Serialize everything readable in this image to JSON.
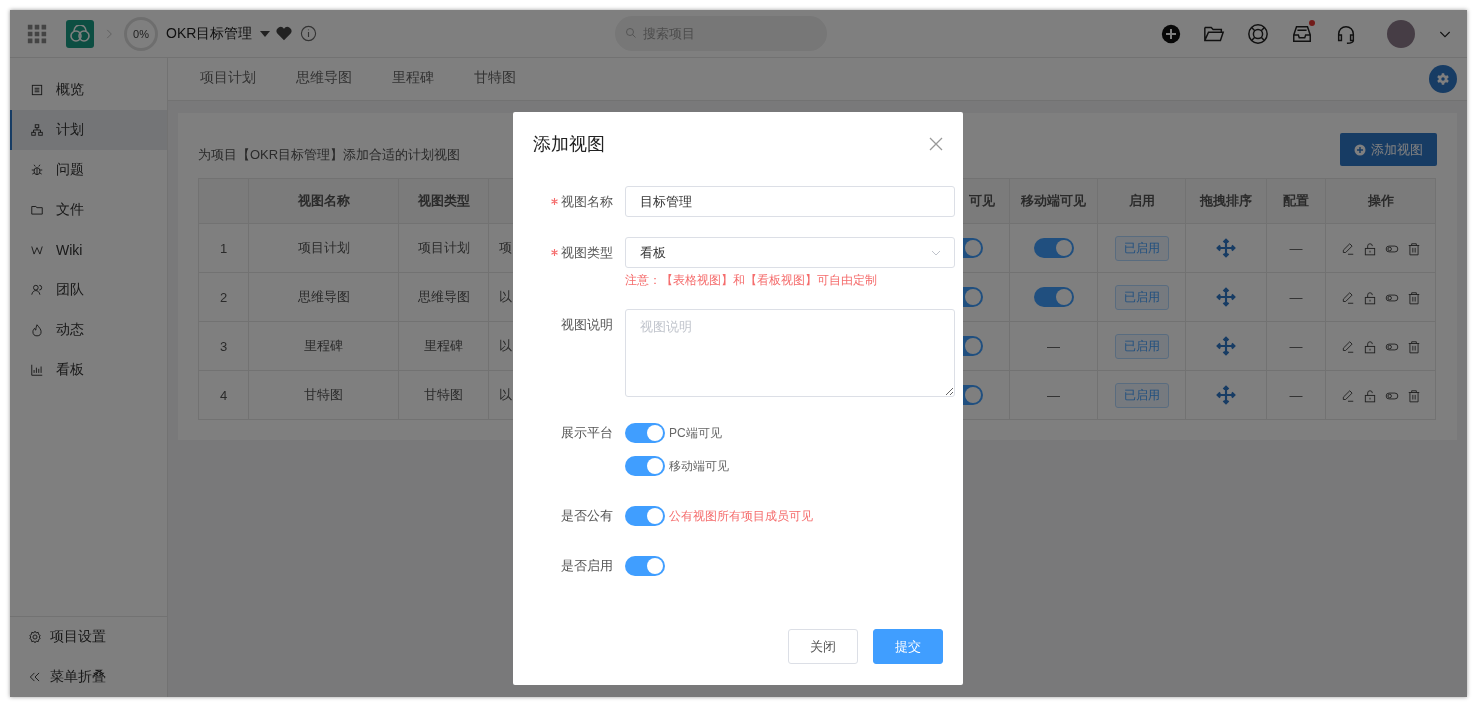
{
  "top_bar": {
    "progress": "0%",
    "project": "OKR目标管理",
    "search": {
      "placeholder": "搜索项目"
    },
    "has_notification": true
  },
  "sidebar": {
    "items": [
      {
        "label": "概览",
        "selected": false
      },
      {
        "label": "计划",
        "selected": true
      },
      {
        "label": "问题",
        "selected": false
      },
      {
        "label": "文件",
        "selected": false
      },
      {
        "label": "Wiki",
        "selected": false
      },
      {
        "label": "团队",
        "selected": false
      },
      {
        "label": "动态",
        "selected": false
      },
      {
        "label": "看板",
        "selected": false
      }
    ],
    "footer": [
      {
        "label": "项目设置"
      },
      {
        "label": "菜单折叠"
      }
    ]
  },
  "tabs": [
    {
      "label": "项目计划",
      "selected": false
    },
    {
      "label": "思维导图",
      "selected": false
    },
    {
      "label": "里程碑",
      "selected": false
    },
    {
      "label": "甘特图",
      "selected": false
    }
  ],
  "content": {
    "description": "为项目【OKR目标管理】添加合适的计划视图",
    "add_button": "添加视图",
    "table": {
      "columns": {
        "name": "视图名称",
        "type": "视图类型",
        "column_5": "可见",
        "mobile": "移动端可见",
        "enabled": "启用",
        "sort": "拖拽排序",
        "config": "配置",
        "actions": "操作"
      },
      "rows": [
        {
          "index": "1",
          "name": "项目计划",
          "type": "项目计划",
          "column_4": "项",
          "pc_on": true,
          "mobile": {
            "kind": "toggle",
            "on": true
          },
          "status": "已启用",
          "config": "—"
        },
        {
          "index": "2",
          "name": "思维导图",
          "type": "思维导图",
          "column_4": "以",
          "pc_on": true,
          "mobile": {
            "kind": "toggle",
            "on": true
          },
          "status": "已启用",
          "config": "—"
        },
        {
          "index": "3",
          "name": "里程碑",
          "type": "里程碑",
          "column_4": "以",
          "pc_on": true,
          "mobile": {
            "kind": "text",
            "text": "—"
          },
          "status": "已启用",
          "config": "—"
        },
        {
          "index": "4",
          "name": "甘特图",
          "type": "甘特图",
          "column_4": "以",
          "pc_on": true,
          "mobile": {
            "kind": "text",
            "text": "—"
          },
          "status": "已启用",
          "config": "—"
        }
      ]
    }
  },
  "modal": {
    "title": "添加视图",
    "fields": [
      {
        "kind": "input",
        "label": "视图名称",
        "required": true,
        "value": "目标管理"
      },
      {
        "kind": "select",
        "label": "视图类型",
        "required": true,
        "value": "看板",
        "note": "注意：【表格视图】和【看板视图】可自由定制"
      },
      {
        "kind": "textarea",
        "label": "视图说明",
        "required": false,
        "placeholder": "视图说明"
      },
      {
        "kind": "switches",
        "label": "展示平台",
        "required": false,
        "switches": [
          {
            "on": true,
            "text": "PC端可见",
            "highlight": false
          },
          {
            "on": true,
            "text": "移动端可见",
            "highlight": false
          }
        ]
      },
      {
        "kind": "switches",
        "label": "是否公有",
        "required": false,
        "switches": [
          {
            "on": true,
            "text": "公有视图所有项目成员可见",
            "highlight": true
          }
        ]
      },
      {
        "kind": "switches",
        "label": "是否启用",
        "required": false,
        "switches": [
          {
            "on": true
          }
        ]
      }
    ],
    "buttons": [
      {
        "label": "关闭",
        "kind": "default"
      },
      {
        "label": "提交",
        "kind": "primary"
      }
    ]
  }
}
